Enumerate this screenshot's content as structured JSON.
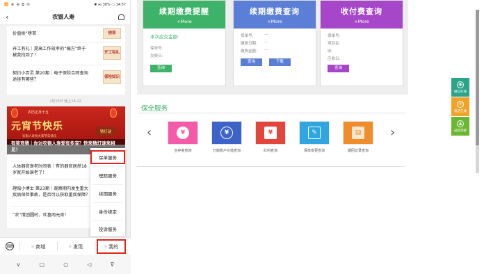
{
  "phone": {
    "status": {
      "left": "📶 ⊗ ⊕ ⧉ ✉",
      "right": "✱ ⋈ 36% ▭ 14:57"
    },
    "title": "农银人寿",
    "back_icon": "‹",
    "articles_top": [
      {
        "title": "价值侯”榜首",
        "thumb": "榜首"
      },
      {
        "title": "开工有礼｜提高工作效率的“偏方”终于被我找到了！",
        "thumb": "开工有礼"
      },
      {
        "title": "契约小百灵 第20期｜电子保险合同查询途径有哪些？",
        "thumb": "保险知识"
      }
    ],
    "timestamp": "2月15日 晚上18:22",
    "banner": {
      "small": "农历正月十五",
      "big": "元宵节快乐",
      "sub": "农银人寿祝大家节日快乐",
      "tag": "猜灯谜",
      "caption": "有奖竞猜｜你对农银人寿爱有多深？快来猜灯谜来相见！"
    },
    "articles_bottom": [
      {
        "title": "人体器官衰老时间表｜有的器官居然18岁就开始衰老了！"
      },
      {
        "title": "理赔小博士 第23期｜观察期内发生重大疾病保险事故，是否可以获取重疾保障？"
      },
      {
        "title": "“农”情团圆时，欢喜闹元宵！"
      }
    ],
    "popup_menu": [
      {
        "label": "保单服务",
        "active": true
      },
      {
        "label": "理赔服务",
        "active": false
      },
      {
        "label": "续期服务",
        "active": false
      },
      {
        "label": "身份绑定",
        "active": false
      },
      {
        "label": "投诉服务",
        "active": false
      }
    ],
    "bottom_nav": {
      "keyboard_icon": "⌨",
      "items": [
        {
          "label": "商城"
        },
        {
          "label": "发现"
        },
        {
          "label": "我的"
        }
      ]
    },
    "system_nav": [
      "∨",
      "▢",
      "○",
      "◁",
      "⊽"
    ]
  },
  "desktop": {
    "query_cards": [
      {
        "title": "续期缴费提醒",
        "more": "+More",
        "color": "#3fb26a",
        "subtitle": "本次应交金额:",
        "rows": [
          {
            "k": "保单号:",
            "v": ""
          },
          {
            "k": "交费日:",
            "v": ""
          }
        ],
        "buttons": [
          "查询"
        ]
      },
      {
        "title": "续期缴费查询",
        "more": "+More",
        "color": "#5b7fd6",
        "subtitle": "",
        "rows": [
          {
            "k": "保单号:",
            "v": "—"
          },
          {
            "k": "缴费日期:",
            "v": "—"
          },
          {
            "k": "缴费金额:",
            "v": "—"
          }
        ],
        "buttons": [
          "查询",
          "下载"
        ]
      },
      {
        "title": "收付费查询",
        "more": "+More",
        "color": "#a646c9",
        "subtitle": "",
        "rows": [
          {
            "k": "保单号:",
            "v": ""
          },
          {
            "k": "项目名:",
            "v": ""
          },
          {
            "k": "收:",
            "v": ""
          },
          {
            "k": "应收日:",
            "v": ""
          }
        ],
        "buttons": [
          "查询"
        ]
      }
    ],
    "section_title": "保全服务",
    "arrow_left": "‹",
    "arrow_right": "›",
    "services": [
      {
        "label": "生存金查询",
        "color": "#f45aa8",
        "glyph": "¥"
      },
      {
        "label": "万能账户价值查询",
        "color": "#3e63c8",
        "glyph": "¥"
      },
      {
        "label": "红利查询",
        "color": "#e2453b",
        "glyph": "¥"
      },
      {
        "label": "保单变更查询",
        "color": "#2fa6e0",
        "glyph": "✎"
      },
      {
        "label": "期回记录查询",
        "color": "#f08c2a",
        "glyph": "▤"
      }
    ],
    "side_widget": [
      {
        "label": "微信在线",
        "color": "#2aa58a",
        "glyph": "◉"
      },
      {
        "label": "电话在线",
        "color": "#f0a328",
        "glyph": "☏"
      },
      {
        "label": "返回顶部",
        "color": "#69b830",
        "glyph": "▲"
      }
    ]
  }
}
